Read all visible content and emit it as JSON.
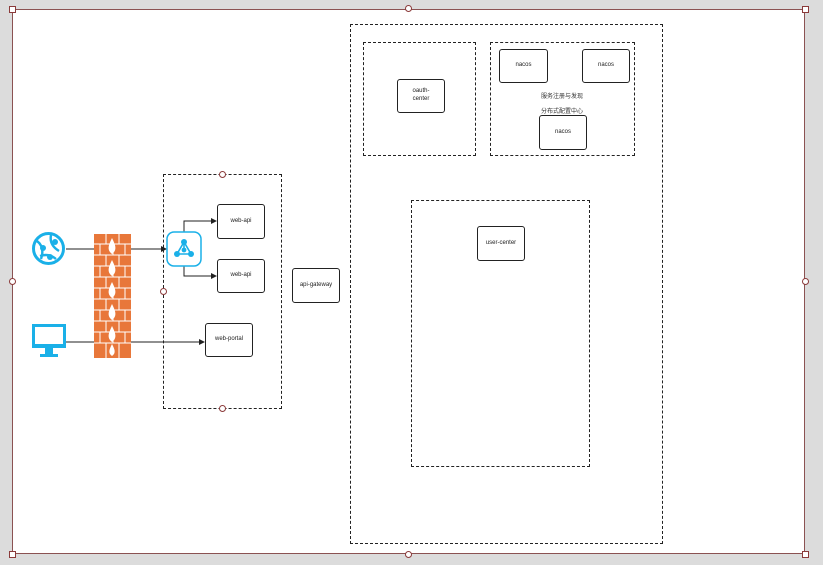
{
  "nodes": {
    "web_api_1": "web-api",
    "web_api_2": "web-api",
    "web_portal": "web-portal",
    "api_gateway": "api-gateway",
    "oauth_center": "oauth-\ncenter",
    "nacos_1": "nacos",
    "nacos_2": "nacos",
    "nacos_3": "nacos",
    "user_center": "user-center"
  },
  "labels": {
    "service_registry": "服务注册与发现",
    "config_center": "分布式配置中心"
  },
  "colors": {
    "accent": "#1ab0e8",
    "firewall": "#e8773a",
    "selection": "#8b3a3a"
  },
  "icons": [
    "globe-network-icon",
    "monitor-icon",
    "firewall-icon",
    "load-balancer-icon"
  ]
}
